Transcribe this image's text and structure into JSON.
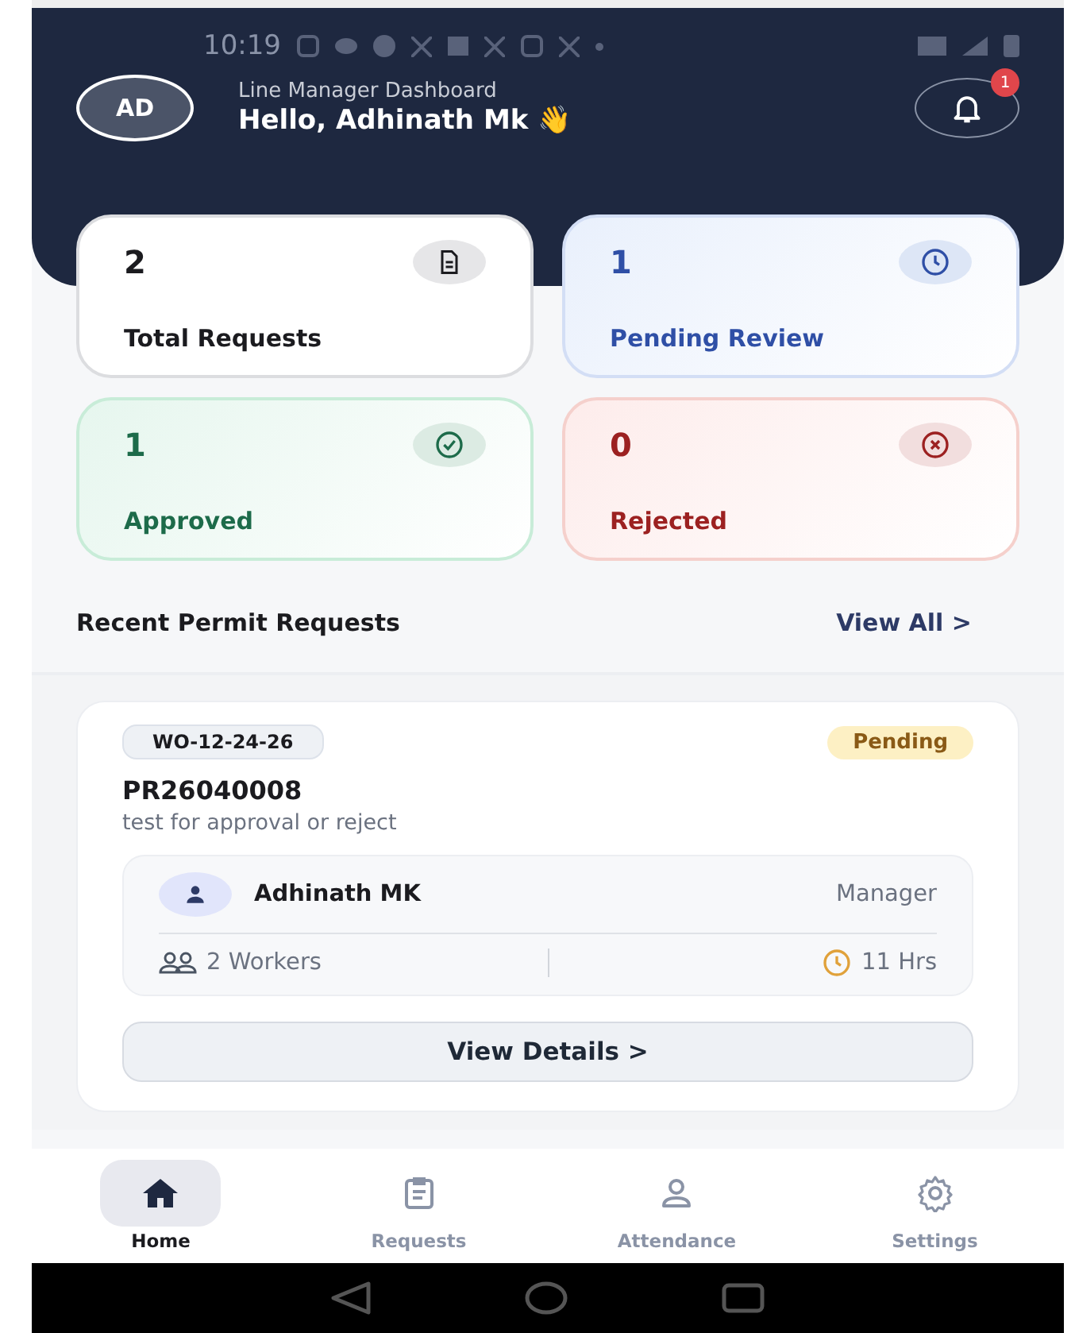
{
  "status_bar": {
    "time": "10:19"
  },
  "header": {
    "avatar": "AD",
    "subtitle": "Line Manager Dashboard",
    "greeting": "Hello, Adhinath Mk 👋",
    "notification_count": "1"
  },
  "stats": [
    {
      "kind": "total",
      "value": "2",
      "label": "Total Requests"
    },
    {
      "kind": "pending",
      "value": "1",
      "label": "Pending Review"
    },
    {
      "kind": "approved",
      "value": "1",
      "label": "Approved"
    },
    {
      "kind": "rejected",
      "value": "0",
      "label": "Rejected"
    }
  ],
  "section": {
    "title": "Recent Permit Requests",
    "link": "View All >"
  },
  "requests": [
    {
      "work_order": "WO-12-24-26",
      "status": "Pending",
      "id": "PR26040008",
      "description": "test for approval or reject",
      "person": "Adhinath MK",
      "role": "Manager",
      "workers": "2 Workers",
      "hours": "11 Hrs",
      "action": "View Details >"
    }
  ],
  "nav": [
    {
      "kind": "home",
      "label": "Home",
      "selected": true
    },
    {
      "kind": "requests",
      "label": "Requests",
      "selected": false
    },
    {
      "kind": "attendance",
      "label": "Attendance",
      "selected": false
    },
    {
      "kind": "settings",
      "label": "Settings",
      "selected": false
    }
  ]
}
